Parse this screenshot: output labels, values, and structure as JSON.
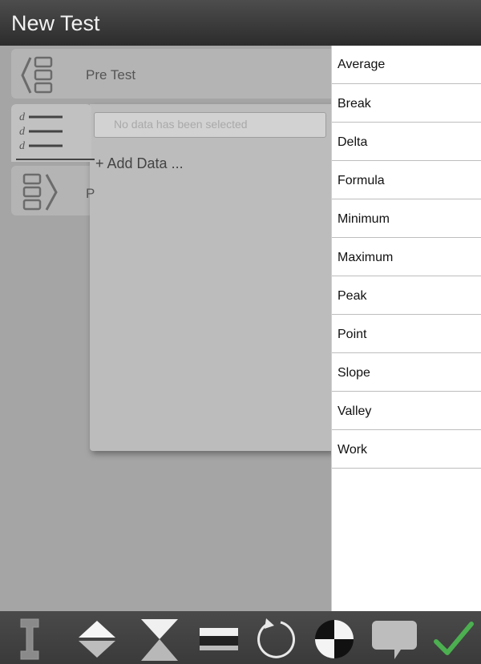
{
  "window": {
    "title": "New Test"
  },
  "steps": {
    "pre_test": {
      "label": "Pre Test"
    },
    "data": {
      "field_placeholder": "No data has been selected",
      "add_label": "+ Add Data ..."
    },
    "post_test": {
      "label_visible": "P"
    }
  },
  "menu": {
    "items": [
      "Average",
      "Break",
      "Delta",
      "Formula",
      "Minimum",
      "Maximum",
      "Peak",
      "Point",
      "Slope",
      "Valley",
      "Work"
    ]
  },
  "toolbar": {
    "icons": [
      "specimen-icon",
      "up-down-icon",
      "hourglass-icon",
      "rectangle-icon",
      "rotate-icon",
      "quadrant-icon",
      "comment-icon",
      "checkmark-icon"
    ]
  },
  "colors": {
    "accept": "#4caf50",
    "titlebar": "#3a3a3a",
    "toolbar": "#424242"
  }
}
